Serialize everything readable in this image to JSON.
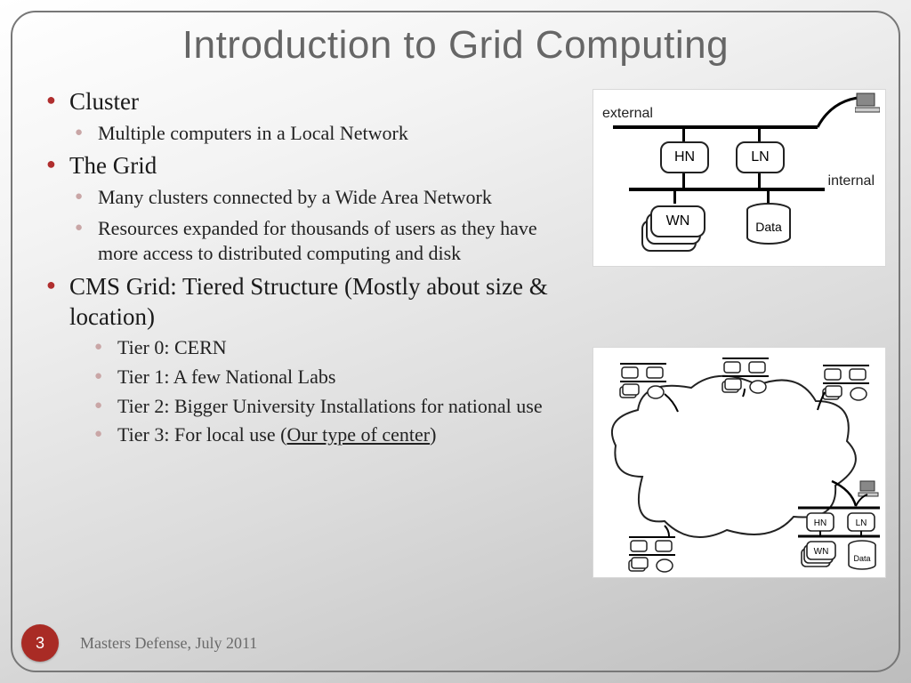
{
  "title": "Introduction to Grid Computing",
  "bullets": {
    "cluster": {
      "label": "Cluster",
      "sub1": "Multiple computers in a Local Network"
    },
    "grid": {
      "label": "The Grid",
      "sub1": "Many clusters connected by a Wide Area Network",
      "sub2": "Resources expanded for thousands of users as they have more access to distributed computing and disk"
    },
    "cms": {
      "label": "CMS Grid: Tiered Structure (Mostly about size & location)",
      "tier0": "Tier 0: CERN",
      "tier1": "Tier 1: A few National Labs",
      "tier2": "Tier 2: Bigger University Installations for national use",
      "tier3_prefix": "Tier 3: For local use (",
      "tier3_underline": "Our type of center",
      "tier3_suffix": ")"
    }
  },
  "diagram1": {
    "external": "external",
    "internal": "internal",
    "HN": "HN",
    "LN": "LN",
    "WN": "WN",
    "Data": "Data"
  },
  "diagram2": {
    "HN": "HN",
    "LN": "LN",
    "WN": "WN",
    "Data": "Data"
  },
  "page_number": "3",
  "footer": "Masters Defense, July 2011"
}
